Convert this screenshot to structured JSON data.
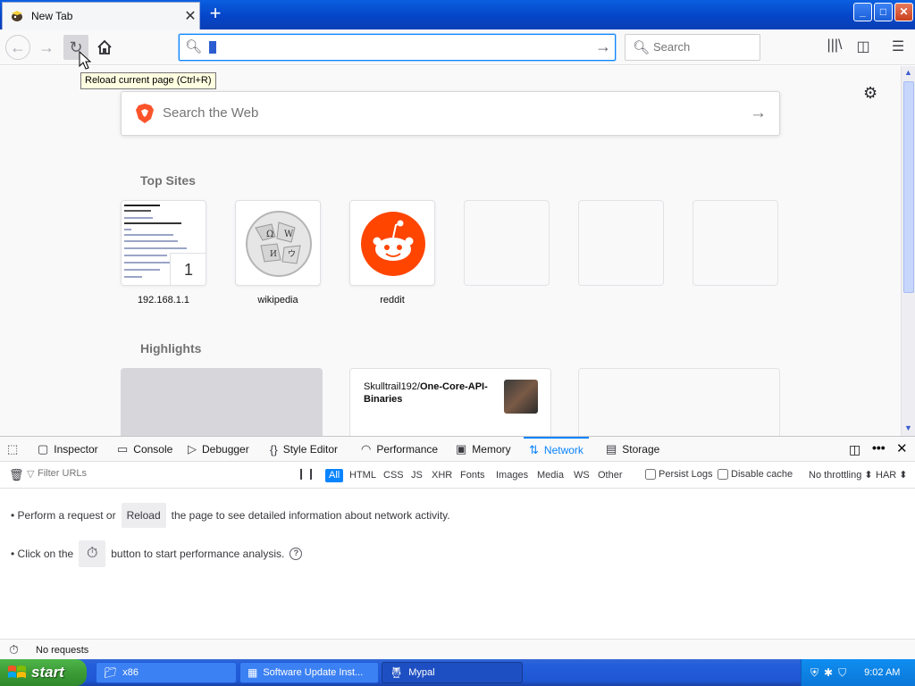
{
  "browser": {
    "tab": {
      "title": "New Tab"
    },
    "newtab_glyph": "+",
    "window_controls": {
      "minimize": "_",
      "maximize": "□",
      "close": "✕"
    },
    "toolbar": {
      "url_value": "",
      "search_placeholder": "Search",
      "reload_tooltip": "Reload current page (Ctrl+R)"
    }
  },
  "newtab": {
    "web_search_placeholder": "Search the Web",
    "top_sites_title": "Top Sites",
    "top_sites": [
      {
        "label": "192.168.1.1",
        "pinned_number": "1"
      },
      {
        "label": "wikipedia"
      },
      {
        "label": "reddit"
      }
    ],
    "highlights_title": "Highlights",
    "highlight_card": {
      "owner": "Skulltrail192/",
      "repo": "One-Core-API-Binaries"
    }
  },
  "devtools": {
    "tabs": [
      {
        "label": "Inspector"
      },
      {
        "label": "Console"
      },
      {
        "label": "Debugger"
      },
      {
        "label": "Style Editor"
      },
      {
        "label": "Performance"
      },
      {
        "label": "Memory"
      },
      {
        "label": "Network"
      },
      {
        "label": "Storage"
      }
    ],
    "selected_tab": "Network",
    "filter_placeholder": "Filter URLs",
    "type_filters": [
      "All",
      "HTML",
      "CSS",
      "JS",
      "XHR",
      "Fonts",
      "Images",
      "Media",
      "WS",
      "Other"
    ],
    "persist_logs": "Persist Logs",
    "disable_cache": "Disable cache",
    "throttling": "No throttling ⬍",
    "har": "HAR ⬍",
    "empty_line1_pre": "• Perform a request or",
    "empty_line1_btn": "Reload",
    "empty_line1_post": "the page to see detailed information about network activity.",
    "empty_line2_pre": "• Click on the",
    "empty_line2_post": "button to start performance analysis.",
    "status": "No requests"
  },
  "taskbar": {
    "start_label": "start",
    "tasks": [
      {
        "label": "x86"
      },
      {
        "label": "Software Update Inst..."
      },
      {
        "label": "Mypal"
      }
    ],
    "clock": "9:02 AM"
  },
  "colors": {
    "accent": "#0a84ff",
    "xp_blue": "#245edb",
    "start_green": "#3c9b37",
    "reddit": "#ff4500",
    "brave": "#fb542b"
  }
}
